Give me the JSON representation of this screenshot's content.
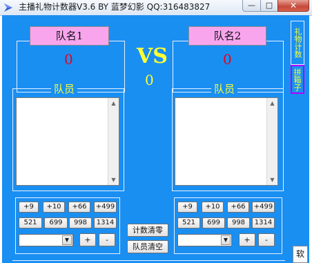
{
  "window": {
    "title": "主播礼物计数器V3.6  BY 蓝梦幻影 QQ:316483827",
    "min_glyph": "—",
    "max_glyph": "□",
    "close_glyph": "✕"
  },
  "vs_label": "VS",
  "vs_total": "0",
  "teams": [
    {
      "name": "队名1",
      "score": "0",
      "members_label": "队员",
      "increment_buttons": [
        "+9",
        "+10",
        "+66",
        "+499"
      ],
      "preset_buttons": [
        "521",
        "699",
        "998",
        "1314"
      ],
      "combo_value": "",
      "plus_label": "+",
      "minus_label": "-"
    },
    {
      "name": "队名2",
      "score": "0",
      "members_label": "队员",
      "increment_buttons": [
        "+9",
        "+10",
        "+66",
        "+499"
      ],
      "preset_buttons": [
        "521",
        "699",
        "998",
        "1314"
      ],
      "combo_value": "",
      "plus_label": "+",
      "minus_label": "-"
    }
  ],
  "center_buttons": {
    "reset_count": "计数清零",
    "clear_members": "队员清空"
  },
  "side_tabs": [
    "礼物计数",
    "拼箱子"
  ],
  "bottom_tab": "软",
  "colors": {
    "background": "#1a8ff2",
    "accent_yellow": "#ffff33",
    "team_label": "#f9a5ee",
    "score_red": "#e8001a"
  }
}
